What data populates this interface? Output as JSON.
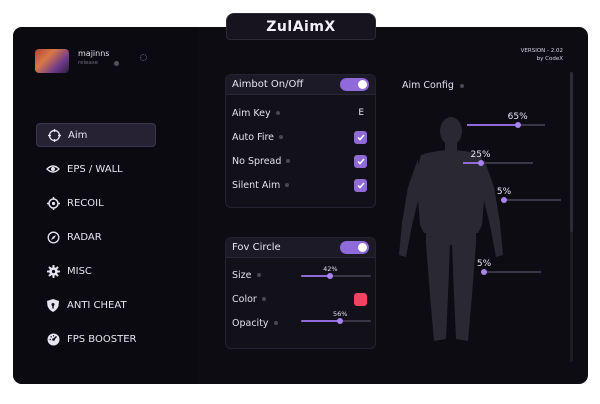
{
  "app": {
    "title_main": "ZulAim",
    "title_accent": "X",
    "version": "VERSION - 2.02",
    "author": "by CodeX"
  },
  "profile": {
    "username": "majinns",
    "status": "release"
  },
  "nav": {
    "items": [
      {
        "label": "Aim",
        "icon": "crosshair-icon",
        "active": true
      },
      {
        "label": "EPS / WALL",
        "icon": "eye-icon",
        "active": false
      },
      {
        "label": "RECOIL",
        "icon": "target-icon",
        "active": false
      },
      {
        "label": "RADAR",
        "icon": "compass-icon",
        "active": false
      },
      {
        "label": "MISC",
        "icon": "gear-icon",
        "active": false
      },
      {
        "label": "ANTI CHEAT",
        "icon": "shield-icon",
        "active": false
      },
      {
        "label": "FPS BOOSTER",
        "icon": "speedometer-icon",
        "active": false
      }
    ]
  },
  "aimbot_panel": {
    "header": "Aimbot On/Off",
    "enabled": true,
    "aim_key_label": "Aim Key",
    "aim_key_value": "E",
    "auto_fire_label": "Auto Fire",
    "auto_fire": true,
    "no_spread_label": "No Spread",
    "no_spread": true,
    "silent_aim_label": "Silent Aim",
    "silent_aim": true
  },
  "fov_panel": {
    "header": "Fov Circle",
    "enabled": true,
    "size_label": "Size",
    "size_value": 42,
    "size_text": "42%",
    "color_label": "Color",
    "color": "#f04462",
    "opacity_label": "Opacity",
    "opacity_value": 56,
    "opacity_text": "56%"
  },
  "aim_config": {
    "label": "Aim Config",
    "sliders": [
      {
        "part": "head",
        "value": 65,
        "text": "65%"
      },
      {
        "part": "chest",
        "value": 25,
        "text": "25%"
      },
      {
        "part": "arms",
        "value": 5,
        "text": "5%"
      },
      {
        "part": "legs",
        "value": 5,
        "text": "5%"
      }
    ]
  },
  "colors": {
    "accent": "#8f6ad9",
    "background": "#0d0c12",
    "color_swatch": "#f04462"
  }
}
